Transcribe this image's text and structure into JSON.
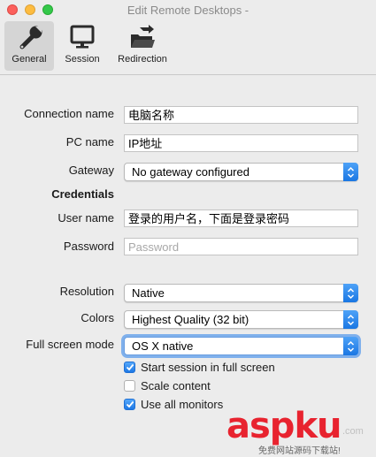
{
  "window": {
    "title": "Edit Remote Desktops -"
  },
  "toolbar": {
    "tabs": [
      {
        "label": "General",
        "icon": "wrench-icon",
        "selected": true
      },
      {
        "label": "Session",
        "icon": "monitor-icon",
        "selected": false
      },
      {
        "label": "Redirection",
        "icon": "folder-redirect-icon",
        "selected": false
      }
    ]
  },
  "form": {
    "connection_name": {
      "label": "Connection name",
      "value": "电脑名称"
    },
    "pc_name": {
      "label": "PC name",
      "value": "IP地址"
    },
    "gateway": {
      "label": "Gateway",
      "value": "No gateway configured"
    },
    "credentials": {
      "label": "Credentials"
    },
    "user_name": {
      "label": "User name",
      "value": "登录的用户名，下面是登录密码"
    },
    "password": {
      "label": "Password",
      "placeholder": "Password"
    },
    "resolution": {
      "label": "Resolution",
      "value": "Native"
    },
    "colors": {
      "label": "Colors",
      "value": "Highest Quality (32 bit)"
    },
    "full_screen_mode": {
      "label": "Full screen mode",
      "value": "OS X native"
    },
    "options": [
      {
        "label": "Start session in full screen",
        "checked": true
      },
      {
        "label": "Scale content",
        "checked": false
      },
      {
        "label": "Use all monitors",
        "checked": true
      }
    ]
  },
  "watermark": {
    "brand_red": "asp",
    "brand_blue": "ku",
    "suffix": ".com",
    "tagline": "免费网站源码下载站!"
  },
  "colors": {
    "accent": "#1a77e3",
    "background": "#ececec"
  }
}
